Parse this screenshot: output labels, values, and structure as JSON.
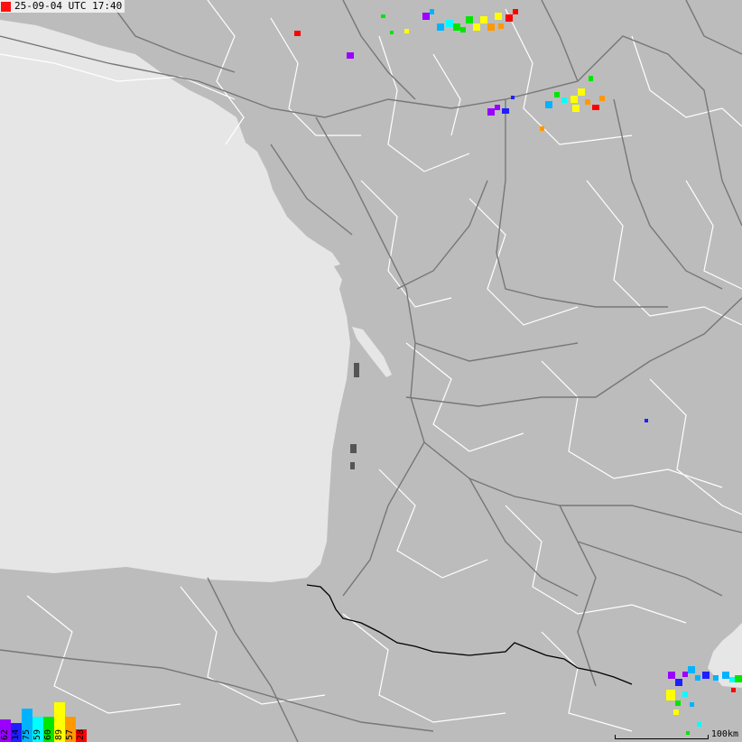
{
  "timestamp": {
    "text": "25-09-04 UTC 17:40",
    "marker_color": "#ff1010"
  },
  "legend": {
    "bins": [
      {
        "label": "62",
        "color": "#9900ff",
        "level": 0.55
      },
      {
        "label": "14",
        "color": "#1f1fff",
        "level": 0.45
      },
      {
        "label": "75",
        "color": "#00b3ff",
        "level": 0.8
      },
      {
        "label": "59",
        "color": "#00ffff",
        "level": 0.6
      },
      {
        "label": "60",
        "color": "#00e600",
        "level": 0.6
      },
      {
        "label": "89",
        "color": "#ffff00",
        "level": 0.95
      },
      {
        "label": "57",
        "color": "#ff9900",
        "level": 0.6
      },
      {
        "label": "28",
        "color": "#ff0000",
        "level": 0.3
      }
    ]
  },
  "scale_bar": {
    "label": "100km"
  },
  "colors": {
    "sea": "#e6e6e6",
    "land": "#bcbcbc",
    "roads": "#777777",
    "admin_borders": "#ffffff",
    "national_border": "#000000"
  }
}
